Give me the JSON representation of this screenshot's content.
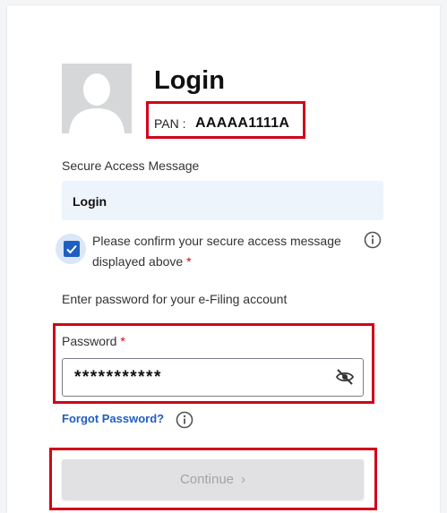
{
  "login": {
    "title": "Login",
    "pan_label": "PAN :",
    "pan_value": "AAAAA1111A"
  },
  "secure_access": {
    "label": "Secure Access Message",
    "message": "Login",
    "confirm_text": "Please confirm your secure access message displayed above",
    "required_mark": "*",
    "checked": true
  },
  "password": {
    "instruction": "Enter password for your e-Filing account",
    "label": "Password",
    "required_mark": "*",
    "value": "***********",
    "forgot_link": "Forgot Password?"
  },
  "continue_button": {
    "label": "Continue",
    "chevron": "›"
  },
  "colors": {
    "accent": "#1f5fbf",
    "highlight_border": "#d0021b",
    "disabled_button": "#e1e1e3"
  },
  "icons": [
    "avatar-placeholder",
    "check-icon",
    "info-icon",
    "eye-off-icon",
    "chevron-right-icon"
  ]
}
